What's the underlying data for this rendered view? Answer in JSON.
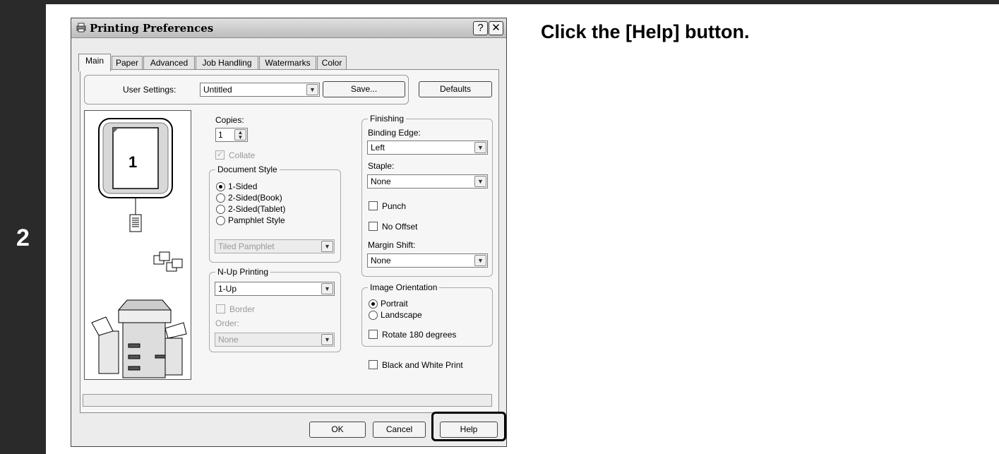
{
  "step_number": "2",
  "instruction": "Click the [Help] button.",
  "dialog": {
    "title": "Printing Preferences",
    "help_glyph": "?",
    "close_glyph": "✕",
    "tabs": [
      "Main",
      "Paper",
      "Advanced",
      "Job Handling",
      "Watermarks",
      "Color"
    ],
    "active_tab": "Main"
  },
  "user_settings": {
    "label": "User Settings:",
    "value": "Untitled",
    "save_button": "Save...",
    "defaults_button": "Defaults"
  },
  "preview": {
    "page_number": "1"
  },
  "copies": {
    "label": "Copies:",
    "value": "1",
    "collate_label": "Collate",
    "collate_checked": true,
    "collate_enabled": false
  },
  "document_style": {
    "title": "Document Style",
    "options": [
      "1-Sided",
      "2-Sided(Book)",
      "2-Sided(Tablet)",
      "Pamphlet Style"
    ],
    "selected": "1-Sided",
    "pamphlet_select": "Tiled Pamphlet"
  },
  "nup": {
    "title": "N-Up Printing",
    "value": "1-Up",
    "border_label": "Border",
    "order_label": "Order:",
    "order_value": "None"
  },
  "finishing": {
    "title": "Finishing",
    "binding_edge_label": "Binding Edge:",
    "binding_edge_value": "Left",
    "staple_label": "Staple:",
    "staple_value": "None",
    "punch_label": "Punch",
    "no_offset_label": "No Offset",
    "margin_shift_label": "Margin Shift:",
    "margin_shift_value": "None"
  },
  "image_orientation": {
    "title": "Image Orientation",
    "options": [
      "Portrait",
      "Landscape"
    ],
    "selected": "Portrait",
    "rotate_label": "Rotate 180 degrees"
  },
  "bw_print_label": "Black and White Print",
  "buttons": {
    "ok": "OK",
    "cancel": "Cancel",
    "help": "Help"
  },
  "colors": {
    "step_bar": "#2a2a2a",
    "dialog_bg": "#ececec"
  },
  "icons": [
    "printer-icon",
    "help-icon",
    "close-icon",
    "dropdown-arrow-icon",
    "spinner-icon",
    "document-icon",
    "pamphlet-icon",
    "copier-machine-icon"
  ]
}
